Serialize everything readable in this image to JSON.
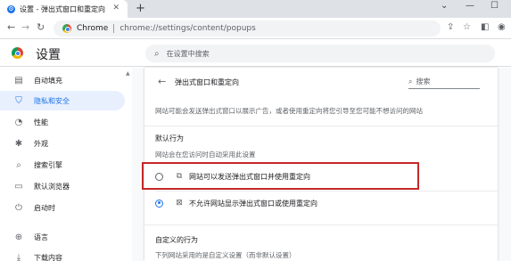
{
  "browser": {
    "tab_title": "设置 - 弹出式窗口和重定向",
    "tab_favicon": "gear-icon",
    "close_glyph": "✕",
    "new_tab_glyph": "+",
    "window_controls": [
      "⌄",
      "—",
      "☐"
    ],
    "address": {
      "chip": "Chrome",
      "url": "chrome://settings/content/popups"
    },
    "nav": {
      "back": "←",
      "forward": "→",
      "reload": "↻"
    },
    "toolbar_icons": [
      "share-icon",
      "star-icon",
      "sidepanel-icon",
      "profile-icon"
    ]
  },
  "settings": {
    "title": "设置",
    "search_placeholder": "在设置中搜索",
    "sidebar": [
      {
        "label": "自动填充",
        "icon": "autofill-icon",
        "glyph": "▤",
        "active": false
      },
      {
        "label": "隐私和安全",
        "icon": "shield-icon",
        "glyph": "⛉",
        "active": true
      },
      {
        "label": "性能",
        "icon": "performance-icon",
        "glyph": "◔",
        "active": false
      },
      {
        "label": "外观",
        "icon": "palette-icon",
        "glyph": "✱",
        "active": false
      },
      {
        "label": "搜索引擎",
        "icon": "search-icon",
        "glyph": "⌕",
        "active": false
      },
      {
        "label": "默认浏览器",
        "icon": "browser-icon",
        "glyph": "▭",
        "active": false
      },
      {
        "label": "启动时",
        "icon": "power-icon",
        "glyph": "⏻",
        "active": false
      },
      {
        "label": "语言",
        "icon": "globe-icon",
        "glyph": "⊕",
        "active": false
      },
      {
        "label": "下载内容",
        "icon": "download-icon",
        "glyph": "⤓",
        "active": false
      }
    ]
  },
  "page": {
    "title": "弹出式窗口和重定向",
    "search_label": "搜索",
    "description": "网站可能会发送弹出式窗口以展示广告，或者使用重定向将您引导至您可能不想访问的网站",
    "default_behavior": {
      "title": "默认行为",
      "subtitle": "网站会在您访问时自动采用此设置",
      "options": [
        {
          "label": "网站可以发送弹出式窗口并使用重定向",
          "icon": "open-in-new-icon",
          "glyph": "⧉",
          "checked": false
        },
        {
          "label": "不允许网站显示弹出式窗口或使用重定向",
          "icon": "popup-blocked-icon",
          "glyph": "⊠",
          "checked": true
        }
      ]
    },
    "custom_behavior": {
      "title": "自定义的行为",
      "subtitle": "下列网站采用的是自定义设置（而非默认设置）"
    }
  },
  "colors": {
    "accent": "#1a73e8",
    "highlight_box": "#c62828"
  }
}
